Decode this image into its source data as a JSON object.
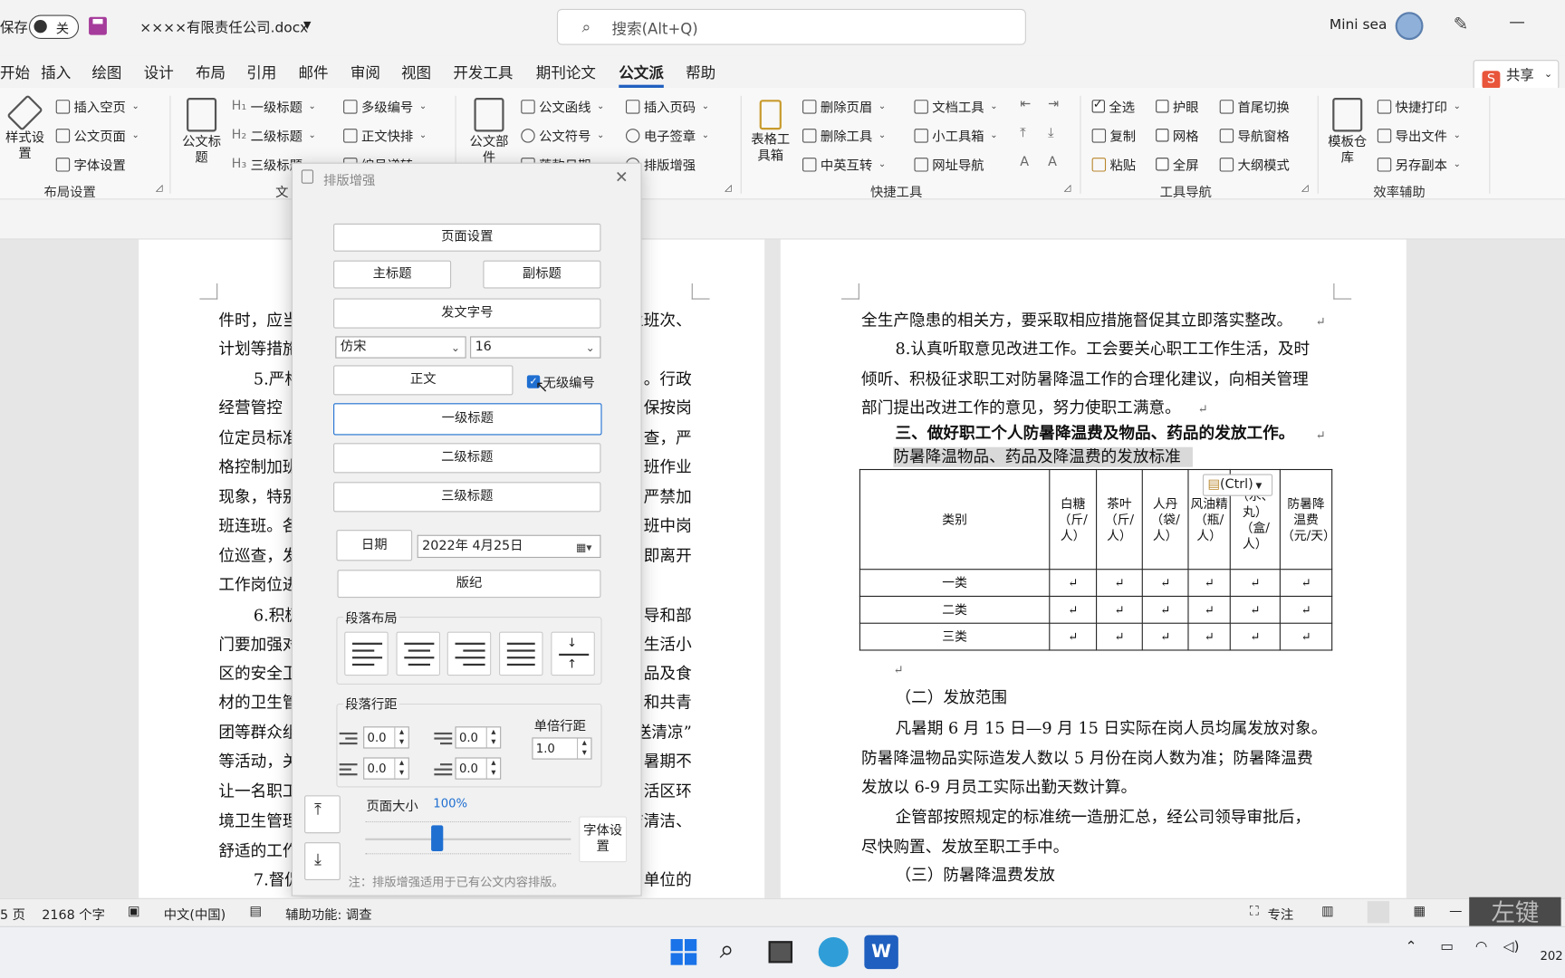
{
  "titlebar": {
    "autosave_label": "保存",
    "autosave_state": "关",
    "filename": "××××有限责任公司.docx",
    "search_placeholder": "搜索(Alt+Q)",
    "user_name": "Mini sea"
  },
  "tabs": [
    "开始",
    "插入",
    "绘图",
    "设计",
    "布局",
    "引用",
    "邮件",
    "审阅",
    "视图",
    "开发工具",
    "期刊论文",
    "公文派",
    "帮助"
  ],
  "active_tab": "公文派",
  "ribbon": {
    "style_settings": "样式设置",
    "insert_blank_page": "插入空页",
    "doc_page": "公文页面",
    "font_settings": "字体设置",
    "layout_group": "布局设置",
    "doc_title": "公文标题",
    "h1": "一级标题",
    "h2": "二级标题",
    "h3": "三级标题",
    "multi_number": "多级编号",
    "body_layout": "正文快排",
    "numbering_partial": "编号递转",
    "text_group_partial": "文",
    "doc_parts": "公文部件",
    "doc_letter": "公文函线",
    "doc_symbol": "公文符号",
    "insert_page_num": "插入页码",
    "e_signature": "电子签章",
    "layout_enhance": "排版增强",
    "drop_date_partial": "落款日期",
    "table_toolbox": "表格工具箱",
    "delete_header": "删除页眉",
    "delete_tool": "删除工具",
    "cn_en_switch": "中英互转",
    "doc_tools": "文档工具",
    "mini_toolbox": "小工具箱",
    "url_nav": "网址导航",
    "quick_tools": "快捷工具",
    "select_all": "全选",
    "copy": "复制",
    "paste": "粘贴",
    "eye_protect": "护眼",
    "grid": "网格",
    "fullscreen": "全屏",
    "first_last_switch": "首尾切换",
    "nav_pane": "导航窗格",
    "outline_mode": "大纲模式",
    "tool_nav": "工具导航",
    "template_repo": "模板仓库",
    "quick_print": "快捷打印",
    "export_file": "导出文件",
    "save_copy": "另存副本",
    "efficiency": "效率辅助",
    "share_partial": "共享"
  },
  "dialog": {
    "title": "排版增强",
    "page_setup": "页面设置",
    "main_title": "主标题",
    "sub_title": "副标题",
    "doc_number": "发文字号",
    "font_name": "仿宋",
    "font_size": "16",
    "body": "正文",
    "no_level_number_label": "无级编号",
    "no_level_number_checked": true,
    "h1": "一级标题",
    "h2": "二级标题",
    "h3": "三级标题",
    "date_btn": "日期",
    "date_value": "2022年  4月25日",
    "colophon": "版纪",
    "paragraph_layout": "段落布局",
    "paragraph_spacing": "段落行距",
    "spin_values": [
      "0.0",
      "0.0",
      "0.0",
      "0.0"
    ],
    "line_spacing_label": "单倍行距",
    "line_spacing_value": "1.0",
    "page_size_label": "页面大小",
    "page_size_value": "100%",
    "zoom_fraction": 0.35,
    "font_setting_btn": "字体设置",
    "note": "注：排版增强适用于已有公文内容排版。"
  },
  "left_page": {
    "lines": [
      {
        "t": "件时，应当",
        "r": "业班次、"
      },
      {
        "t": "计划等措施",
        "r": ""
      },
      {
        "t": "5.严格",
        "r": "。行政"
      },
      {
        "t": "经营管控",
        "r": "保按岗"
      },
      {
        "t": "位定员标准",
        "r": "查，严"
      },
      {
        "t": "格控制加班",
        "r": "班作业"
      },
      {
        "t": "现象，特别",
        "r": "严禁加"
      },
      {
        "t": "班连班。各",
        "r": "班中岗"
      },
      {
        "t": "位巡查，发",
        "r": "即离开"
      },
      {
        "t": "工作岗位进",
        "r": ""
      },
      {
        "t": "6.积极",
        "r": "导和部"
      },
      {
        "t": "门要加强对",
        "r": "生活小"
      },
      {
        "t": "区的安全卫",
        "r": "品及食"
      },
      {
        "t": "材的卫生管",
        "r": "和共青"
      },
      {
        "t": "团等群众组",
        "r": "送清凉”"
      },
      {
        "t": "等活动，关",
        "r": "暑期不"
      },
      {
        "t": "让一名职工",
        "r": "活区环"
      },
      {
        "t": "境卫生管理",
        "r": "洁清洁、"
      },
      {
        "t": "舒适的工作",
        "r": ""
      },
      {
        "t": "7.督促",
        "r": "单位的"
      }
    ]
  },
  "right_page": {
    "lines": [
      "全生产隐患的相关方，要采取相应措施督促其立即落实整改。",
      "8.认真听取意见改进工作。工会要关心职工工作生活，及时",
      "倾听、积极征求职工对防暑降温工作的合理化建议，向相关管理",
      "部门提出改进工作的意见，努力使职工满意。"
    ],
    "heading3": "三、做好职工个人防暑降温费及物品、药品的发放工作。",
    "table_caption": "防暑降温物品、药品及降温费的发放标准",
    "table_headers": [
      "类别",
      "白糖（斤/人）",
      "茶叶（斤/人）",
      "人丹（袋/人）",
      "风油精（瓶/人）",
      "（水、丸）（盒/人）",
      "防暑降温费（元/天）"
    ],
    "table_rows": [
      "一类",
      "二类",
      "三类"
    ],
    "paste_ctrl": "(Ctrl)",
    "after": [
      "（二）发放范围",
      "凡暑期 6 月 15 日—9 月 15 日实际在岗人员均属发放对象。",
      "防暑降温物品实际造发人数以 5 月份在岗人数为准；防暑降温费",
      "发放以 6-9 月员工实际出勤天数计算。",
      "企管部按照规定的标准统一造册汇总，经公司领导审批后，",
      "尽快购置、发放至职工手中。",
      "（三）防暑降温费发放"
    ]
  },
  "status": {
    "pages": "5 页",
    "words": "2168 个字",
    "language": "中文(中国)",
    "accessibility": "辅助功能: 调查",
    "focus": "专注",
    "watermark": "左键"
  },
  "taskbar": {
    "clock_partial": "202"
  }
}
